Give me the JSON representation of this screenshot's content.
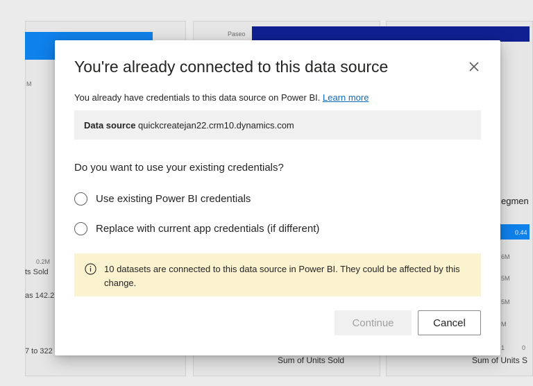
{
  "background": {
    "top_label": "Paseo",
    "left_axis_top": "M",
    "left_axis_mid": "0.2M",
    "left_series_label": "ts Sold",
    "left_value": "as 142.2",
    "left_range": "7 to 322",
    "right_title": "egmen",
    "right_bar_value": "0.44",
    "right_ticks": [
      "6M",
      "5M",
      "5M",
      "M"
    ],
    "right_axis_bottom": [
      "1",
      "0"
    ],
    "bottom_axis_label": "Sum of Units Sold",
    "right_bottom_label": "Sum of Units S"
  },
  "dialog": {
    "title": "You're already connected to this data source",
    "description": "You already have credentials to this data source on Power BI.",
    "learn_more": "Learn more",
    "data_source_label": "Data source",
    "data_source_value": "quickcreatejan22.crm10.dynamics.com",
    "question": "Do you want to use your existing credentials?",
    "options": [
      "Use existing Power BI credentials",
      "Replace with current app credentials (if different)"
    ],
    "warning": "10 datasets are connected to this data source in Power BI. They could be affected by this change.",
    "continue_label": "Continue",
    "cancel_label": "Cancel"
  },
  "colors": {
    "accent_blue": "#118dff",
    "navy": "#12239e",
    "warning_bg": "#fbf2d0",
    "link": "#0f6cbd"
  },
  "icons": {
    "close": "close-icon",
    "info": "info-icon"
  }
}
